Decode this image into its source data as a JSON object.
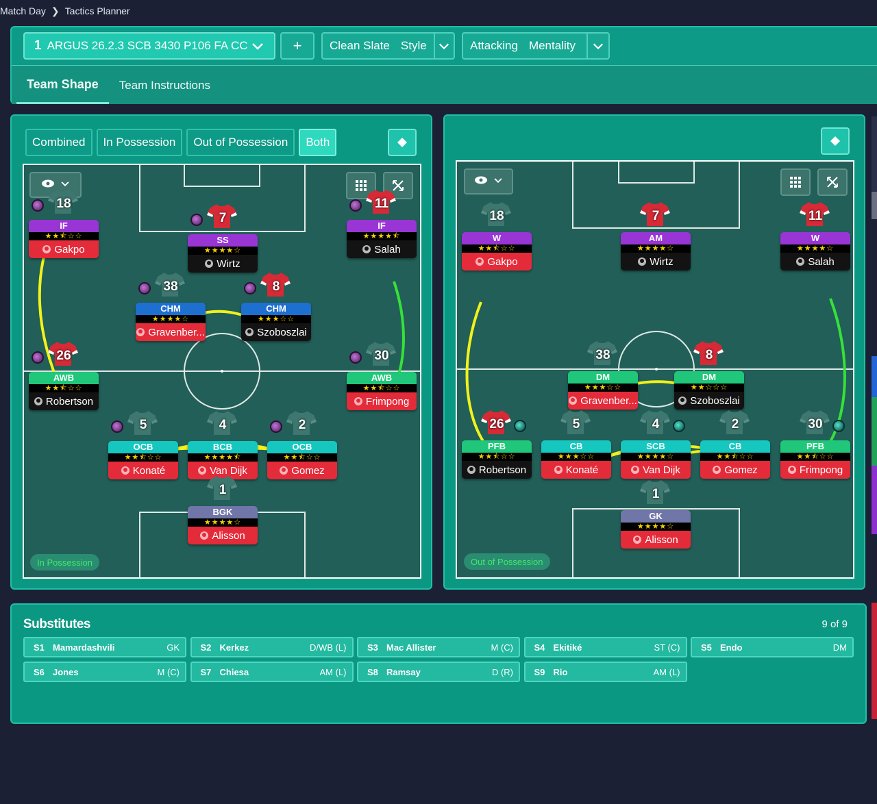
{
  "breadcrumb": {
    "parent": "Match Day",
    "current": "Tactics Planner"
  },
  "tactic": {
    "number": "1",
    "name": "ARGUS 26.2.3 SCB 3430 P106 FA CC"
  },
  "add_label": "+",
  "style": {
    "value": "Clean Slate",
    "label": "Style"
  },
  "mentality": {
    "value": "Attacking",
    "label": "Mentality"
  },
  "tabs": [
    "Team Shape",
    "Team Instructions"
  ],
  "view_modes": [
    "Combined",
    "In Possession",
    "Out of Possession",
    "Both"
  ],
  "left_phase": "In Possession",
  "right_phase": "Out of Possession",
  "colors": {
    "accent": "#0b9883",
    "star": "#f5d000",
    "link_yellow": "#f2f21a",
    "link_green": "#36e03a"
  },
  "players_left": [
    {
      "num": "18",
      "role": "IF",
      "stars": "★★⯪☆☆",
      "name": "Gakpo",
      "style": "red",
      "badge": "purple",
      "shirt": "grey",
      "rc": "if"
    },
    {
      "num": "7",
      "role": "SS",
      "stars": "★★★★☆",
      "name": "Wirtz",
      "style": "black",
      "badge": "purple",
      "shirt": "red",
      "rc": "ss"
    },
    {
      "num": "11",
      "role": "IF",
      "stars": "★★★★⯪",
      "name": "Salah",
      "style": "black",
      "badge": "purple",
      "shirt": "red",
      "rc": "if"
    },
    {
      "num": "38",
      "role": "CHM",
      "stars": "★★★★☆",
      "name": "Gravenber...",
      "style": "red",
      "badge": "purple",
      "shirt": "grey",
      "rc": "chm"
    },
    {
      "num": "8",
      "role": "CHM",
      "stars": "★★★☆☆",
      "name": "Szoboszlai",
      "style": "black",
      "badge": "purple",
      "shirt": "red",
      "rc": "chm"
    },
    {
      "num": "26",
      "role": "AWB",
      "stars": "★★⯪☆☆",
      "name": "Robertson",
      "style": "black",
      "badge": "purple",
      "shirt": "red",
      "rc": "awb"
    },
    {
      "num": "30",
      "role": "AWB",
      "stars": "★★⯪☆☆",
      "name": "Frimpong",
      "style": "red",
      "badge": "purple",
      "shirt": "grey",
      "rc": "awb"
    },
    {
      "num": "5",
      "role": "OCB",
      "stars": "★★⯪☆☆",
      "name": "Konaté",
      "style": "red",
      "badge": "purple",
      "shirt": "grey",
      "rc": "ocb"
    },
    {
      "num": "4",
      "role": "BCB",
      "stars": "★★★★⯪",
      "name": "Van Dijk",
      "style": "red",
      "badge": "",
      "shirt": "grey",
      "rc": "bcb"
    },
    {
      "num": "2",
      "role": "OCB",
      "stars": "★★⯪☆☆",
      "name": "Gomez",
      "style": "red",
      "badge": "purple",
      "shirt": "grey",
      "rc": "ocb"
    },
    {
      "num": "1",
      "role": "BGK",
      "stars": "★★★★☆",
      "name": "Alisson",
      "style": "red",
      "badge": "",
      "shirt": "grey",
      "rc": "bgk"
    }
  ],
  "players_right": [
    {
      "num": "18",
      "role": "W",
      "stars": "★★⯪☆☆",
      "name": "Gakpo",
      "style": "red",
      "badge": "",
      "shirt": "grey",
      "rc": "w"
    },
    {
      "num": "7",
      "role": "AM",
      "stars": "★★★★☆",
      "name": "Wirtz",
      "style": "black",
      "badge": "",
      "shirt": "red",
      "rc": "am"
    },
    {
      "num": "11",
      "role": "W",
      "stars": "★★★★☆",
      "name": "Salah",
      "style": "black",
      "badge": "",
      "shirt": "red",
      "rc": "w"
    },
    {
      "num": "38",
      "role": "DM",
      "stars": "★★★☆☆",
      "name": "Gravenber...",
      "style": "red",
      "badge": "",
      "shirt": "grey",
      "rc": "dm"
    },
    {
      "num": "8",
      "role": "DM",
      "stars": "★★☆☆☆",
      "name": "Szoboszlai",
      "style": "black",
      "badge": "",
      "shirt": "red",
      "rc": "dm"
    },
    {
      "num": "26",
      "role": "PFB",
      "stars": "★★⯪☆☆",
      "name": "Robertson",
      "style": "black",
      "badge": "teal",
      "shirt": "red",
      "rc": "pfb"
    },
    {
      "num": "5",
      "role": "CB",
      "stars": "★★★☆☆",
      "name": "Konaté",
      "style": "red",
      "badge": "",
      "shirt": "grey",
      "rc": "cb"
    },
    {
      "num": "4",
      "role": "SCB",
      "stars": "★★★★☆",
      "name": "Van Dijk",
      "style": "red",
      "badge": "teal",
      "shirt": "grey",
      "rc": "scb"
    },
    {
      "num": "2",
      "role": "CB",
      "stars": "★★⯪☆☆",
      "name": "Gomez",
      "style": "red",
      "badge": "",
      "shirt": "grey",
      "rc": "cb"
    },
    {
      "num": "30",
      "role": "PFB",
      "stars": "★★⯪☆☆",
      "name": "Frimpong",
      "style": "red",
      "badge": "teal",
      "shirt": "grey",
      "rc": "pfb"
    },
    {
      "num": "1",
      "role": "GK",
      "stars": "★★★★☆",
      "name": "Alisson",
      "style": "red",
      "badge": "",
      "shirt": "grey",
      "rc": "gk"
    }
  ],
  "subs": {
    "title": "Substitutes",
    "count": "9 of 9",
    "items": [
      {
        "slot": "S1",
        "name": "Mamardashvili",
        "pos": "GK"
      },
      {
        "slot": "S2",
        "name": "Kerkez",
        "pos": "D/WB (L)"
      },
      {
        "slot": "S3",
        "name": "Mac Allister",
        "pos": "M (C)"
      },
      {
        "slot": "S4",
        "name": "Ekitiké",
        "pos": "ST (C)"
      },
      {
        "slot": "S5",
        "name": "Endo",
        "pos": "DM"
      },
      {
        "slot": "S6",
        "name": "Jones",
        "pos": "M (C)"
      },
      {
        "slot": "S7",
        "name": "Chiesa",
        "pos": "AM (L)"
      },
      {
        "slot": "S8",
        "name": "Ramsay",
        "pos": "D (R)"
      },
      {
        "slot": "S9",
        "name": "Rio",
        "pos": "AM (L)"
      }
    ]
  }
}
